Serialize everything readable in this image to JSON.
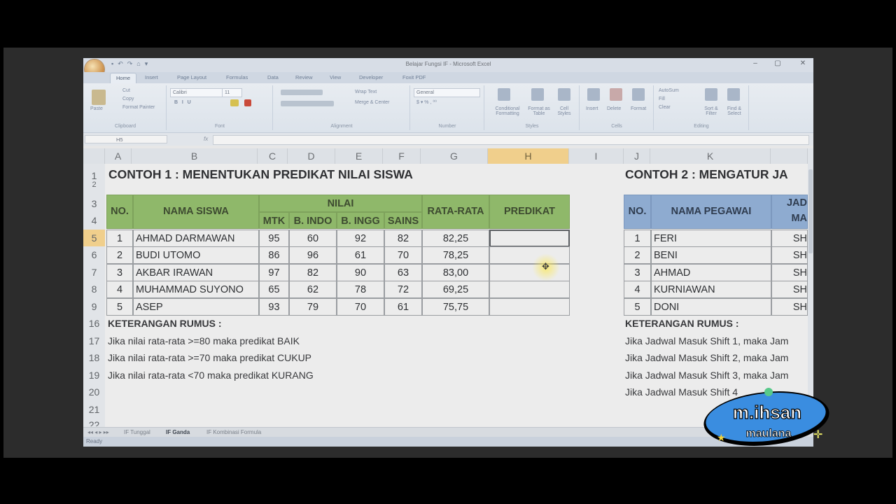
{
  "window": {
    "title": "Belajar Fungsi IF - Microsoft Excel",
    "quick_access": [
      "▪",
      "↶",
      "↷",
      "⌂",
      "▾"
    ],
    "controls": [
      "–",
      "▢",
      "✕"
    ]
  },
  "ribbon_tabs": [
    "Home",
    "Insert",
    "Page Layout",
    "Formulas",
    "Data",
    "Review",
    "View",
    "Developer",
    "Foxit PDF"
  ],
  "ribbon": {
    "clipboard": {
      "paste": "Paste",
      "cut": "Cut",
      "copy": "Copy",
      "format_painter": "Format Painter",
      "label": "Clipboard"
    },
    "font": {
      "name": "Calibri",
      "size": "11",
      "label": "Font"
    },
    "alignment": {
      "wrap": "Wrap Text",
      "merge": "Merge & Center",
      "label": "Alignment"
    },
    "number": {
      "format": "General",
      "label": "Number"
    },
    "styles": {
      "conditional": "Conditional Formatting",
      "format_table": "Format as Table",
      "cell_styles": "Cell Styles",
      "label": "Styles"
    },
    "cells": {
      "insert": "Insert",
      "delete": "Delete",
      "format": "Format",
      "label": "Cells"
    },
    "editing": {
      "autosum": "AutoSum",
      "fill": "Fill",
      "clear": "Clear",
      "sort": "Sort & Filter",
      "find": "Find & Select",
      "label": "Editing"
    }
  },
  "formula_bar": {
    "name_box": "H5",
    "fx": "fx",
    "value": ""
  },
  "columns": [
    "A",
    "B",
    "C",
    "D",
    "E",
    "F",
    "G",
    "H",
    "I",
    "J",
    "K"
  ],
  "rows": [
    "1",
    "2",
    "3",
    "4",
    "5",
    "6",
    "7",
    "8",
    "9",
    "16",
    "17",
    "18",
    "19",
    "20",
    "21",
    "22"
  ],
  "example1": {
    "title": "CONTOH 1 : MENENTUKAN PREDIKAT NILAI SISWA",
    "headers": {
      "no": "NO.",
      "name": "NAMA SISWA",
      "nilai": "NILAI",
      "subjects": [
        "MTK",
        "B. INDO",
        "B. INGG",
        "SAINS"
      ],
      "avg": "RATA-RATA",
      "predikat": "PREDIKAT"
    },
    "students": [
      {
        "no": "1",
        "name": "AHMAD DARMAWAN",
        "mtk": "95",
        "indo": "60",
        "ingg": "92",
        "sains": "82",
        "avg": "82,25"
      },
      {
        "no": "2",
        "name": "BUDI UTOMO",
        "mtk": "86",
        "indo": "96",
        "ingg": "61",
        "sains": "70",
        "avg": "78,25"
      },
      {
        "no": "3",
        "name": "AKBAR IRAWAN",
        "mtk": "97",
        "indo": "82",
        "ingg": "90",
        "sains": "63",
        "avg": "83,00"
      },
      {
        "no": "4",
        "name": "MUHAMMAD SUYONO",
        "mtk": "65",
        "indo": "62",
        "ingg": "78",
        "sains": "72",
        "avg": "69,25"
      },
      {
        "no": "5",
        "name": "ASEP",
        "mtk": "93",
        "indo": "79",
        "ingg": "70",
        "sains": "61",
        "avg": "75,75"
      }
    ],
    "notes_title": "KETERANGAN RUMUS :",
    "notes": [
      "Jika nilai rata-rata >=80 maka predikat BAIK",
      "Jika nilai rata-rata >=70 maka predikat CUKUP",
      "Jika nilai rata-rata <70 maka predikat KURANG"
    ]
  },
  "example2": {
    "title": "CONTOH 2 : MENGATUR JA",
    "headers": {
      "no": "NO.",
      "name": "NAMA PEGAWAI",
      "col3_top": "JAD",
      "col3_bottom": "MA"
    },
    "employees": [
      {
        "no": "1",
        "name": "FERI",
        "shift": "SH"
      },
      {
        "no": "2",
        "name": "BENI",
        "shift": "SH"
      },
      {
        "no": "3",
        "name": "AHMAD",
        "shift": "SH"
      },
      {
        "no": "4",
        "name": "KURNIAWAN",
        "shift": "SH"
      },
      {
        "no": "5",
        "name": "DONI",
        "shift": "SH"
      }
    ],
    "notes_title": "KETERANGAN RUMUS :",
    "notes": [
      "Jika Jadwal Masuk Shift 1, maka Jam",
      "Jika Jadwal Masuk Shift 2, maka Jam",
      "Jika Jadwal Masuk Shift 3, maka Jam",
      "Jika Jadwal Masuk Shift 4"
    ]
  },
  "sheet_tabs": [
    "IF Tunggal",
    "IF Ganda",
    "IF Kombinasi Formula"
  ],
  "active_sheet": "IF Ganda",
  "status": {
    "ready": "Ready"
  },
  "watermark": {
    "name": "m.ihsan",
    "subtitle": "maulana"
  },
  "colors": {
    "green_header": "#8fb86a",
    "blue_header": "#8eabd0",
    "selection": "#f0cf8c",
    "badge": "#3a8de0"
  }
}
